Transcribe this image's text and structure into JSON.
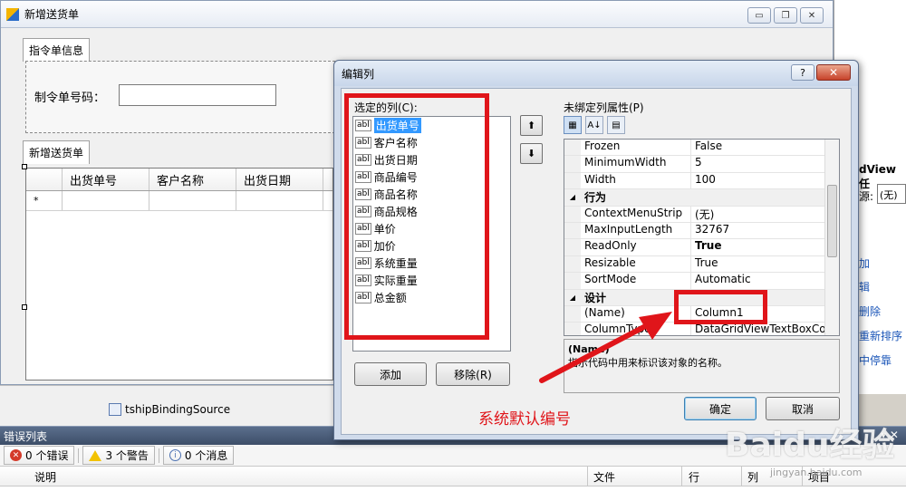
{
  "form": {
    "title": "新增送货单",
    "controls": [
      "▭",
      "❐",
      "✕"
    ],
    "tab1": "指令单信息",
    "order_label": "制令单号码：",
    "tab2": "新增送货单",
    "grid_columns": [
      "出货单号",
      "客户名称",
      "出货日期"
    ],
    "new_row_marker": "*",
    "binding_source": "tshipBindingSource"
  },
  "tasks_panel": {
    "title": "dView 任",
    "source_label": "源:",
    "source_value": "(无)",
    "items": [
      "加",
      "辑",
      "删除",
      "重新排序",
      "中停靠"
    ]
  },
  "dialog": {
    "title": "编辑列",
    "help_button": "?",
    "close_button": "✕",
    "selected_columns_label": "选定的列(C):",
    "columns": [
      "出货单号",
      "客户名称",
      "出货日期",
      "商品编号",
      "商品名称",
      "商品规格",
      "单价",
      "加价",
      "系统重量",
      "实际重量",
      "总金额"
    ],
    "column_prefix": "abl",
    "move_up": "⬆",
    "move_down": "⬇",
    "add_button": "添加",
    "remove_button": "移除(R)",
    "properties_label": "未绑定列属性(P)",
    "properties": [
      {
        "type": "prop",
        "name": "Frozen",
        "value": "False"
      },
      {
        "type": "prop",
        "name": "MinimumWidth",
        "value": "5"
      },
      {
        "type": "prop",
        "name": "Width",
        "value": "100"
      },
      {
        "type": "cat",
        "name": "行为"
      },
      {
        "type": "prop",
        "name": "ContextMenuStrip",
        "value": "(无)"
      },
      {
        "type": "prop",
        "name": "MaxInputLength",
        "value": "32767"
      },
      {
        "type": "prop",
        "name": "ReadOnly",
        "value": "True",
        "bold": true
      },
      {
        "type": "prop",
        "name": "Resizable",
        "value": "True"
      },
      {
        "type": "prop",
        "name": "SortMode",
        "value": "Automatic"
      },
      {
        "type": "cat",
        "name": "设计"
      },
      {
        "type": "prop",
        "name": "(Name)",
        "value": "Column1"
      },
      {
        "type": "prop",
        "name": "ColumnType",
        "value": "DataGridViewTextBoxColu"
      }
    ],
    "desc_title": "(Name)",
    "desc_text": "指示代码中用来标识该对象的名称。",
    "ok_button": "确定",
    "cancel_button": "取消"
  },
  "annotation": {
    "text": "系统默认编号",
    "color": "#e0151a"
  },
  "error_list": {
    "title": "错误列表",
    "pin": "▾ ✕",
    "errors": "0 个错误",
    "warnings": "3 个警告",
    "messages": "0 个消息",
    "columns": [
      "说明",
      "文件",
      "行",
      "列",
      "项目"
    ]
  },
  "watermark": {
    "main": "Baidu经验",
    "sub": "jingyan.baidu.com"
  }
}
